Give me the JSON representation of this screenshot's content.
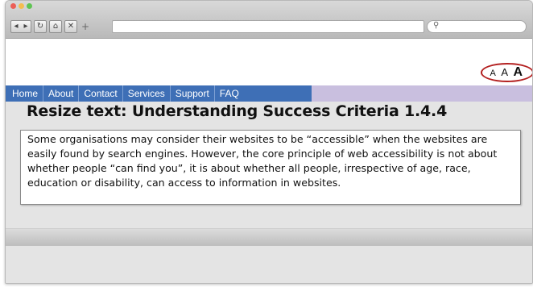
{
  "browser": {
    "nav_icons": [
      "back-icon",
      "forward-icon",
      "reload-icon",
      "home-icon",
      "close-icon",
      "new-tab-icon"
    ],
    "address_value": "",
    "search_icon": "magnifier"
  },
  "text_size": {
    "small": "A",
    "medium": "A",
    "large": "A"
  },
  "nav": {
    "items": [
      "Home",
      "About",
      "Contact",
      "Services",
      "Support",
      "FAQ"
    ]
  },
  "main": {
    "heading": "Resize text: Understanding Success Criteria 1.4.4",
    "body": "Some organisations may consider their websites to be “accessible” when the websites are easily found by search engines. However, the core principle of web accessibility is not about whether people “can find you”, it is about whether all people, irrespective of age, race, education or disability, can access to information in websites."
  },
  "colors": {
    "nav_blue": "#3e6fb6",
    "nav_lavender": "#c9bfdf",
    "text_size_circle": "#b32020"
  }
}
